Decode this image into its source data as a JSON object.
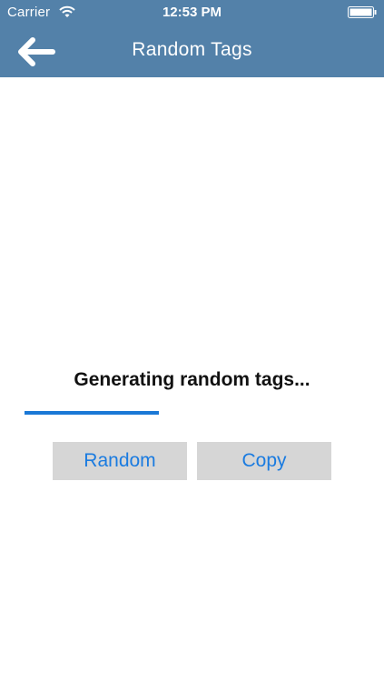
{
  "status_bar": {
    "carrier": "Carrier",
    "time": "12:53 PM"
  },
  "nav": {
    "title": "Random Tags",
    "back_icon": "arrow-left-icon"
  },
  "content": {
    "status_text": "Generating random tags...",
    "progress": 0.4
  },
  "buttons": {
    "random_label": "Random",
    "copy_label": "Copy"
  },
  "colors": {
    "nav_background": "#5381a9",
    "accent": "#1a78d6",
    "button_background": "#d6d6d6"
  }
}
